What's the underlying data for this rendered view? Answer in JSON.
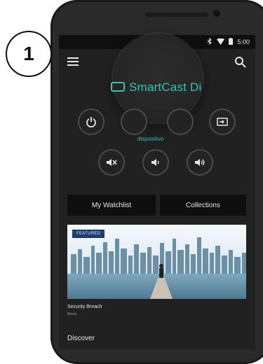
{
  "step_number": "1",
  "status_bar": {
    "time": "5:00"
  },
  "app": {
    "title": "SmartCast Di",
    "hint": "dispositivo"
  },
  "tabs": {
    "watchlist": "My Watchlist",
    "collections": "Collections"
  },
  "featured": {
    "badge": "FEATURED",
    "title": "Security Breach",
    "subtitle": "Movie"
  },
  "sections": {
    "discover": "Discover"
  },
  "icons": {
    "menu": "hamburger-menu-icon",
    "search": "search-icon",
    "cast": "cast-icon",
    "power": "power-icon",
    "input": "input-source-icon",
    "mute": "mute-icon",
    "volume_down": "volume-down-icon",
    "volume_up": "volume-up-icon"
  },
  "colors": {
    "accent": "#35c3b2",
    "background": "#212121",
    "badge": "#1e3d6e"
  }
}
